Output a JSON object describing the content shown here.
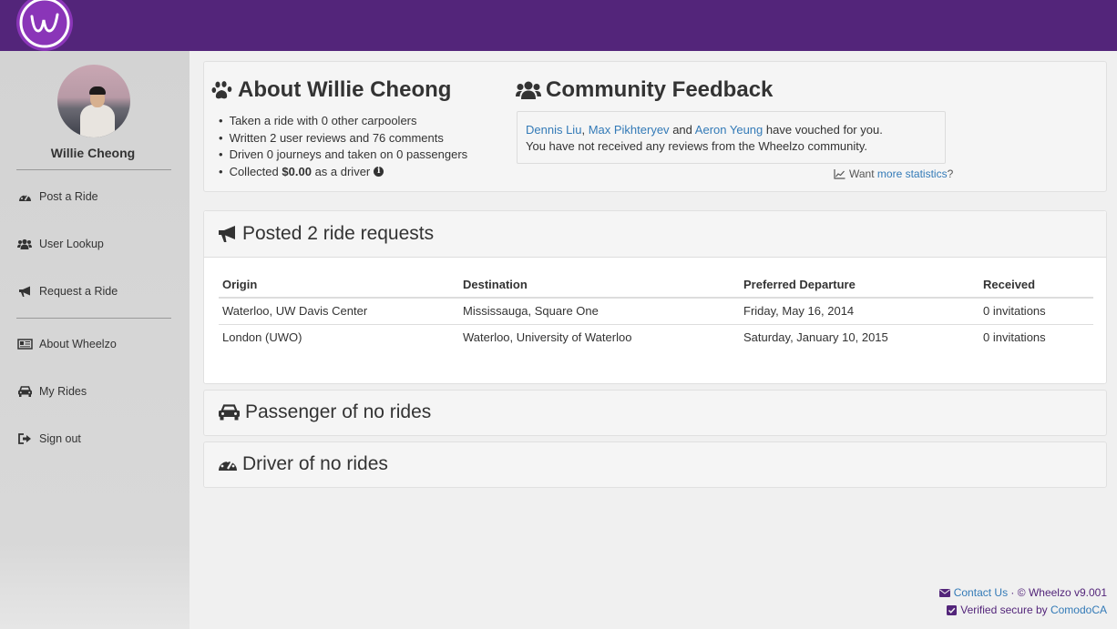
{
  "header": {
    "brand_color": "#53257a"
  },
  "sidebar": {
    "user_name": "Willie Cheong",
    "items": [
      {
        "label": "Post a Ride",
        "icon": "dashboard-icon"
      },
      {
        "label": "User Lookup",
        "icon": "users-icon"
      },
      {
        "label": "Request a Ride",
        "icon": "bullhorn-icon"
      },
      {
        "label": "About Wheelzo",
        "icon": "newspaper-icon"
      },
      {
        "label": "My Rides",
        "icon": "car-icon"
      },
      {
        "label": "Sign out",
        "icon": "sign-out-icon"
      }
    ]
  },
  "about": {
    "title": "About Willie Cheong",
    "stats": [
      "Taken a ride with 0 other carpoolers",
      "Written 2 user reviews and 76 comments",
      "Driven 0 journeys and taken on 0 passengers"
    ],
    "collected_prefix": "Collected",
    "collected_amount": "$0.00",
    "collected_suffix": "as a driver"
  },
  "feedback": {
    "title": "Community Feedback",
    "vouchers": [
      "Dennis Liu",
      "Max Pikhteryev",
      "Aeron Yeung"
    ],
    "sep1": ",",
    "sep2": "and",
    "vouch_suffix": "have vouched for you.",
    "reviews_text": "You have not received any reviews from the Wheelzo community.",
    "want": "Want",
    "more_stats": "more statistics",
    "q": "?"
  },
  "requests": {
    "title": "Posted 2 ride requests",
    "columns": [
      "Origin",
      "Destination",
      "Preferred Departure",
      "Received"
    ],
    "rows": [
      [
        "Waterloo, UW Davis Center",
        "Mississauga, Square One",
        "Friday, May 16, 2014",
        "0 invitations"
      ],
      [
        "London (UWO)",
        "Waterloo, University of Waterloo",
        "Saturday, January 10, 2015",
        "0 invitations"
      ]
    ]
  },
  "passenger": {
    "title": "Passenger of no rides"
  },
  "driver": {
    "title": "Driver of no rides"
  },
  "footer": {
    "contact": "Contact Us",
    "dot": "·",
    "copyright": "© Wheelzo v9.001",
    "verified": "Verified secure by",
    "comodo": "ComodoCA"
  }
}
